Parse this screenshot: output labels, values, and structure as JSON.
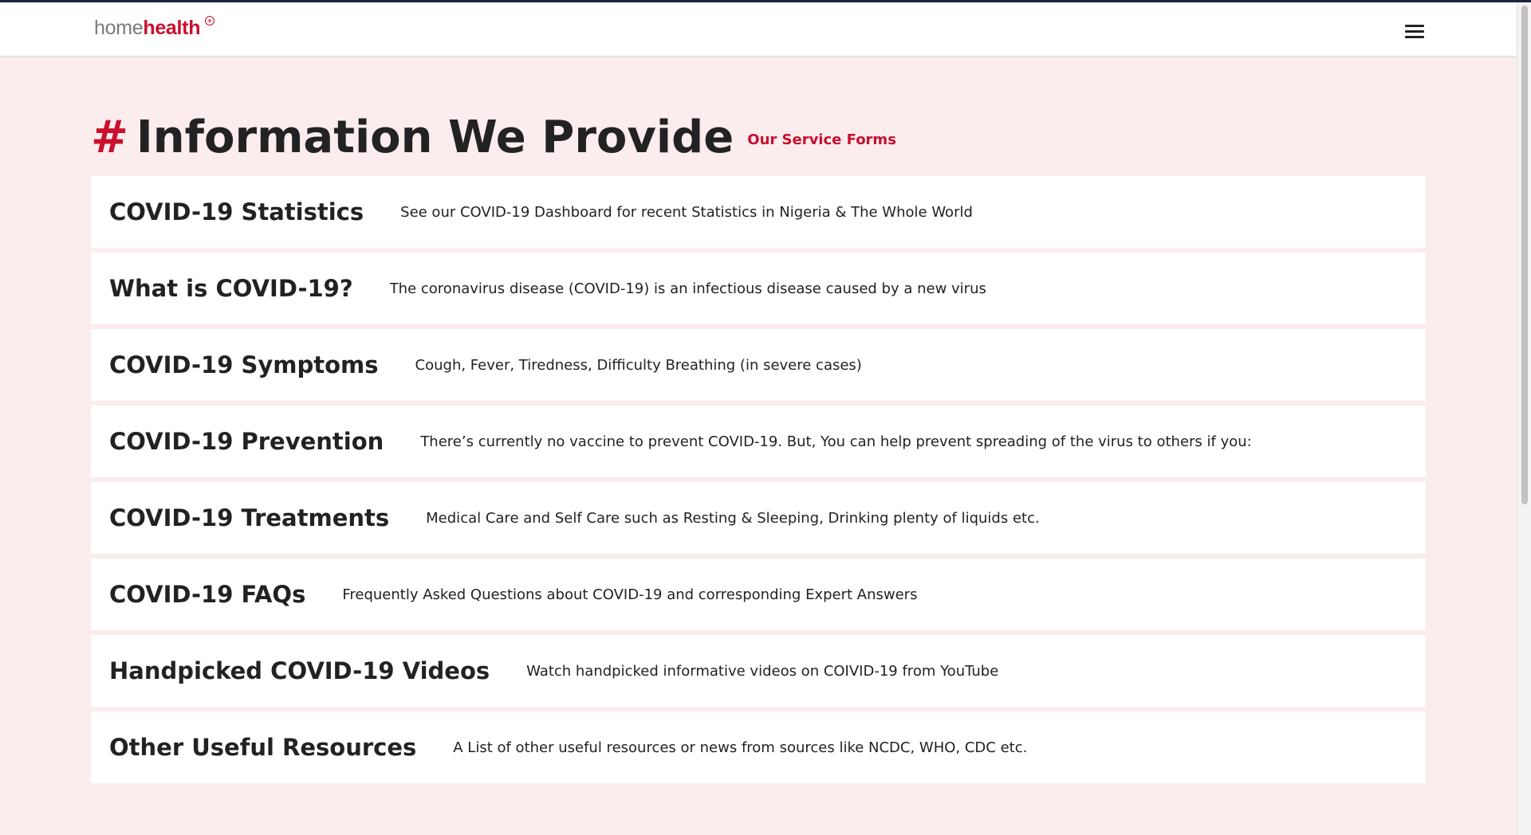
{
  "brand": {
    "home": "home",
    "health": "health",
    "mark": "+"
  },
  "heading": {
    "hash": "#",
    "title": "Information We Provide",
    "link": "Our Service Forms"
  },
  "items": [
    {
      "title": "COVID-19 Statistics",
      "desc": "See our COVID-19 Dashboard for recent Statistics in Nigeria & The Whole World"
    },
    {
      "title": "What is COVID-19?",
      "desc": "The coronavirus disease (COVID-19) is an infectious disease caused by a new virus"
    },
    {
      "title": "COVID-19 Symptoms",
      "desc": "Cough, Fever, Tiredness, Difficulty Breathing (in severe cases)"
    },
    {
      "title": "COVID-19 Prevention",
      "desc": "There’s currently no vaccine to prevent COVID-19. But, You can help prevent spreading of the virus to others if you:"
    },
    {
      "title": "COVID-19 Treatments",
      "desc": "Medical Care and Self Care such as Resting & Sleeping, Drinking plenty of liquids etc."
    },
    {
      "title": "COVID-19 FAQs",
      "desc": "Frequently Asked Questions about COVID-19 and corresponding Expert Answers"
    },
    {
      "title": "Handpicked COVID-19 Videos",
      "desc": "Watch handpicked informative videos on COIVID-19 from YouTube"
    },
    {
      "title": "Other Useful Resources",
      "desc": "A List of other useful resources or news from sources like NCDC, WHO, CDC etc."
    }
  ],
  "colors": {
    "accent": "#c8102e",
    "background": "#fbeced",
    "text": "#222222"
  },
  "icons": {
    "menu": "hamburger-menu-icon"
  }
}
